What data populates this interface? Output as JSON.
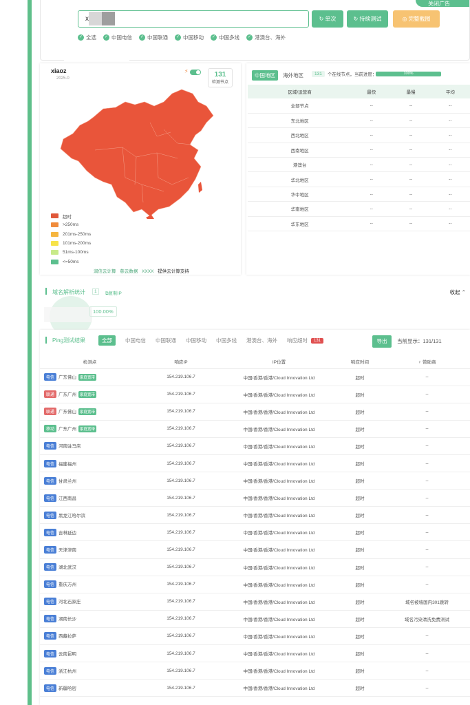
{
  "search": {
    "value": "x",
    "corner_label": "关闭广告",
    "buttons": {
      "single": "单次",
      "continuous": "持续测试",
      "screenshot": "完整截图"
    },
    "filters": [
      "全选",
      "中国电信",
      "中国联通",
      "中国移动",
      "中国多线",
      "港澳台、海外"
    ]
  },
  "map": {
    "title": "xiaoz",
    "date": "2025-0",
    "node_count": "131",
    "node_count_label": "检测节点",
    "legend": [
      {
        "label": "超时",
        "color": "#e0583a"
      },
      {
        "label": ">250ms",
        "color": "#f08c3c"
      },
      {
        "label": "201ms-250ms",
        "color": "#f6b640"
      },
      {
        "label": "101ms-200ms",
        "color": "#f7e34a"
      },
      {
        "label": "51ms-100ms",
        "color": "#c8ea8a"
      },
      {
        "label": "<=50ms",
        "color": "#5cbf8e"
      }
    ],
    "fill_color": "#e9553a",
    "sponsors": [
      "润信云计算",
      "慈云数据",
      "XXXX"
    ],
    "sponsor_suffix": "提供云计算支持"
  },
  "region": {
    "tab_active": "中国地区",
    "tab_other": "海外地区",
    "online_count": "131",
    "online_text": "个在线节点，当前进度：",
    "progress_value": 1.0,
    "progress_label": "100%",
    "columns": [
      "区域/运营商",
      "最快",
      "最慢",
      "平均"
    ],
    "rows": [
      [
        "全部节点",
        "--",
        "--",
        "--"
      ],
      [
        "东北地区",
        "--",
        "--",
        "--"
      ],
      [
        "西北地区",
        "--",
        "--",
        "--"
      ],
      [
        "西南地区",
        "--",
        "--",
        "--"
      ],
      [
        "港澳台",
        "--",
        "--",
        "--"
      ],
      [
        "华北地区",
        "--",
        "--",
        "--"
      ],
      [
        "华中地区",
        "--",
        "--",
        "--"
      ],
      [
        "华南地区",
        "--",
        "--",
        "--"
      ],
      [
        "华东地区",
        "--",
        "--",
        "--"
      ]
    ]
  },
  "dns": {
    "title": "域名解析统计",
    "count": "1",
    "copy_label": "复制IP",
    "collapse_label": "收起",
    "percent": "100.00%"
  },
  "ping": {
    "title": "Ping测试结果",
    "filter_active": "全部",
    "filters": [
      "中国电信",
      "中国联通",
      "中国移动",
      "中国多线",
      "港澳台、海外",
      "响应超时"
    ],
    "timeout_count": "131",
    "export_label": "导出",
    "current_display": "当前显示：131/131",
    "columns": [
      "检测点",
      "响应IP",
      "IP位置",
      "响应时间",
      "赞助商"
    ],
    "isp_colors": {
      "电信": "#4a7fd6",
      "联通": "#e36a6a",
      "移动": "#5cbf8e"
    },
    "rows": [
      {
        "isp": "电信",
        "loc": "广东佛山",
        "tag": "家庭宽带",
        "ip": "154.219.106.7",
        "geo": "中国/香港/香港/Cloud Innovation Ltd",
        "time": "超时",
        "sponsor": "--"
      },
      {
        "isp": "联通",
        "loc": "广东广州",
        "tag": "家庭宽带",
        "ip": "154.219.106.7",
        "geo": "中国/香港/香港/Cloud Innovation Ltd",
        "time": "超时",
        "sponsor": "--"
      },
      {
        "isp": "联通",
        "loc": "广东佛山",
        "tag": "家庭宽带",
        "ip": "154.219.106.7",
        "geo": "中国/香港/香港/Cloud Innovation Ltd",
        "time": "超时",
        "sponsor": "--"
      },
      {
        "isp": "移动",
        "loc": "广东广州",
        "tag": "家庭宽带",
        "ip": "154.219.106.7",
        "geo": "中国/香港/香港/Cloud Innovation Ltd",
        "time": "超时",
        "sponsor": "--"
      },
      {
        "isp": "电信",
        "loc": "河南驻马店",
        "tag": "",
        "ip": "154.219.106.7",
        "geo": "中国/香港/香港/Cloud Innovation Ltd",
        "time": "超时",
        "sponsor": "--"
      },
      {
        "isp": "电信",
        "loc": "福建福州",
        "tag": "",
        "ip": "154.219.106.7",
        "geo": "中国/香港/香港/Cloud Innovation Ltd",
        "time": "超时",
        "sponsor": "--"
      },
      {
        "isp": "电信",
        "loc": "甘肃兰州",
        "tag": "",
        "ip": "154.219.106.7",
        "geo": "中国/香港/香港/Cloud Innovation Ltd",
        "time": "超时",
        "sponsor": "--"
      },
      {
        "isp": "电信",
        "loc": "江西南昌",
        "tag": "",
        "ip": "154.219.106.7",
        "geo": "中国/香港/香港/Cloud Innovation Ltd",
        "time": "超时",
        "sponsor": "--"
      },
      {
        "isp": "电信",
        "loc": "黑龙江哈尔滨",
        "tag": "",
        "ip": "154.219.106.7",
        "geo": "中国/香港/香港/Cloud Innovation Ltd",
        "time": "超时",
        "sponsor": "--"
      },
      {
        "isp": "电信",
        "loc": "吉林延边",
        "tag": "",
        "ip": "154.219.106.7",
        "geo": "中国/香港/香港/Cloud Innovation Ltd",
        "time": "超时",
        "sponsor": "--"
      },
      {
        "isp": "电信",
        "loc": "天津津南",
        "tag": "",
        "ip": "154.219.106.7",
        "geo": "中国/香港/香港/Cloud Innovation Ltd",
        "time": "超时",
        "sponsor": "--"
      },
      {
        "isp": "电信",
        "loc": "湖北武汉",
        "tag": "",
        "ip": "154.219.106.7",
        "geo": "中国/香港/香港/Cloud Innovation Ltd",
        "time": "超时",
        "sponsor": "--"
      },
      {
        "isp": "电信",
        "loc": "重庆万州",
        "tag": "",
        "ip": "154.219.106.7",
        "geo": "中国/香港/香港/Cloud Innovation Ltd",
        "time": "超时",
        "sponsor": "--"
      },
      {
        "isp": "电信",
        "loc": "河北石家庄",
        "tag": "",
        "ip": "154.219.106.7",
        "geo": "中国/香港/香港/Cloud Innovation Ltd",
        "time": "超时",
        "sponsor": "域名被墙国内301跳转"
      },
      {
        "isp": "电信",
        "loc": "湖南长沙",
        "tag": "",
        "ip": "154.219.106.7",
        "geo": "中国/香港/香港/Cloud Innovation Ltd",
        "time": "超时",
        "sponsor": "域名污染清洗免费测试"
      },
      {
        "isp": "电信",
        "loc": "西藏拉萨",
        "tag": "",
        "ip": "154.219.106.7",
        "geo": "中国/香港/香港/Cloud Innovation Ltd",
        "time": "超时",
        "sponsor": "--"
      },
      {
        "isp": "电信",
        "loc": "云南昆明",
        "tag": "",
        "ip": "154.219.106.7",
        "geo": "中国/香港/香港/Cloud Innovation Ltd",
        "time": "超时",
        "sponsor": "--"
      },
      {
        "isp": "电信",
        "loc": "浙江杭州",
        "tag": "",
        "ip": "154.219.106.7",
        "geo": "中国/香港/香港/Cloud Innovation Ltd",
        "time": "超时",
        "sponsor": "--"
      },
      {
        "isp": "电信",
        "loc": "新疆哈密",
        "tag": "",
        "ip": "154.219.106.7",
        "geo": "中国/香港/香港/Cloud Innovation Ltd",
        "time": "超时",
        "sponsor": "--"
      }
    ]
  }
}
